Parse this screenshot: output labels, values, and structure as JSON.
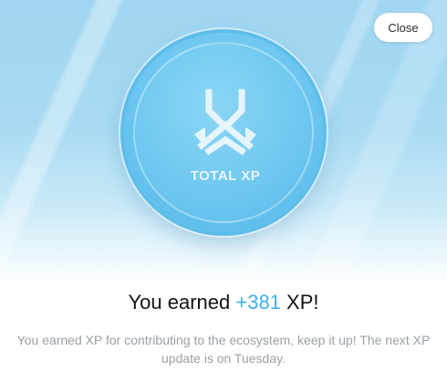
{
  "close_label": "Close",
  "coin": {
    "label": "TOTAL XP",
    "icon": "total-xp-logo-icon"
  },
  "result": {
    "prefix": "You earned",
    "amount": "+381",
    "suffix": "XP!"
  },
  "description": "You earned XP for contributing to the ecosystem, keep it up! The next XP update is on Tuesday.",
  "colors": {
    "accent": "#3fb0e6",
    "coin": "#6cc6f0",
    "hero_background": "#a9dbf3"
  }
}
